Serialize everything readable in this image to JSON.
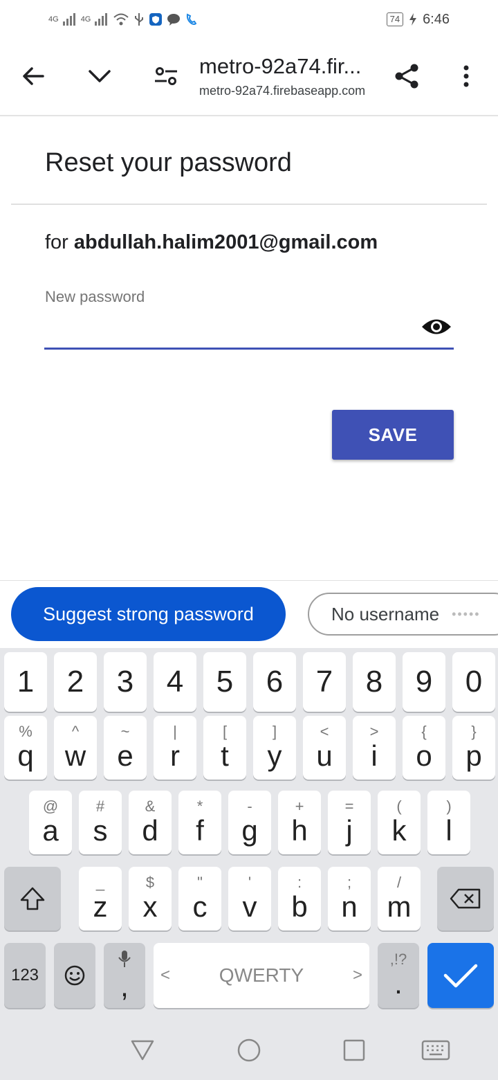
{
  "status_bar": {
    "network1": "4G",
    "network2": "4G",
    "battery": "74",
    "time": "6:46"
  },
  "browser": {
    "title": "metro-92a74.fir...",
    "url": "metro-92a74.firebaseapp.com"
  },
  "page": {
    "heading": "Reset your password",
    "for_prefix": "for",
    "email": "abdullah.halim2001@gmail.com",
    "field_label": "New password",
    "field_value": "",
    "save_label": "SAVE"
  },
  "suggestions": {
    "primary": "Suggest strong password",
    "secondary": "No username",
    "secondary_dots": "•••••"
  },
  "keyboard": {
    "number_row": [
      "1",
      "2",
      "3",
      "4",
      "5",
      "6",
      "7",
      "8",
      "9",
      "0"
    ],
    "row1": [
      {
        "main": "q",
        "hint": "%"
      },
      {
        "main": "w",
        "hint": "^"
      },
      {
        "main": "e",
        "hint": "~"
      },
      {
        "main": "r",
        "hint": "|"
      },
      {
        "main": "t",
        "hint": "["
      },
      {
        "main": "y",
        "hint": "]"
      },
      {
        "main": "u",
        "hint": "<"
      },
      {
        "main": "i",
        "hint": ">"
      },
      {
        "main": "o",
        "hint": "{"
      },
      {
        "main": "p",
        "hint": "}"
      }
    ],
    "row2": [
      {
        "main": "a",
        "hint": "@"
      },
      {
        "main": "s",
        "hint": "#"
      },
      {
        "main": "d",
        "hint": "&"
      },
      {
        "main": "f",
        "hint": "*"
      },
      {
        "main": "g",
        "hint": "-"
      },
      {
        "main": "h",
        "hint": "+"
      },
      {
        "main": "j",
        "hint": "="
      },
      {
        "main": "k",
        "hint": "("
      },
      {
        "main": "l",
        "hint": ")"
      }
    ],
    "row3": [
      {
        "main": "z",
        "hint": "_"
      },
      {
        "main": "x",
        "hint": "$"
      },
      {
        "main": "c",
        "hint": "\""
      },
      {
        "main": "v",
        "hint": "'"
      },
      {
        "main": "b",
        "hint": ":"
      },
      {
        "main": "n",
        "hint": ";"
      },
      {
        "main": "m",
        "hint": "/"
      }
    ],
    "sym_label": "123",
    "comma": ",",
    "space_label": "QWERTY",
    "space_left": "<",
    "space_right": ">",
    "period_hint": ",!?",
    "period": "."
  },
  "colors": {
    "accent": "#3f51b5",
    "chip_primary": "#0b57d0",
    "enter_key": "#1a73e8"
  }
}
